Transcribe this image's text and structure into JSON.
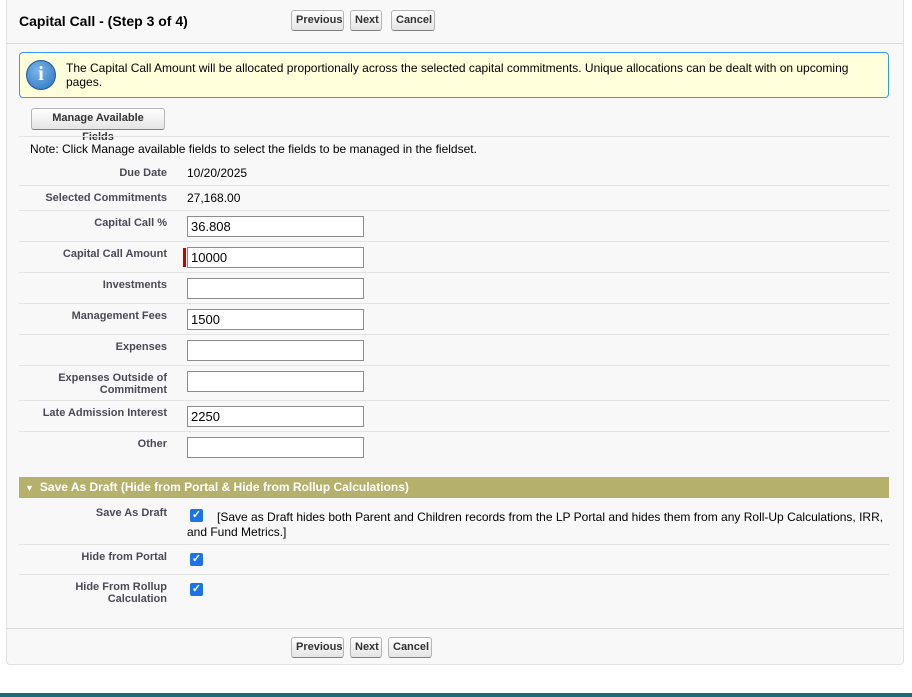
{
  "header": {
    "title": "Capital Call - (Step 3 of 4)"
  },
  "buttons": {
    "previous": "Previous",
    "next": "Next",
    "cancel": "Cancel"
  },
  "info": {
    "icon": "info-icon",
    "text": "The Capital Call Amount will be allocated proportionally across the selected capital commitments. Unique allocations can be dealt with on upcoming pages."
  },
  "manage_fields_label": "Manage Available Fields",
  "note": "Note: Click Manage available fields to select the fields to be managed in the fieldset.",
  "fields": {
    "due_date": {
      "label": "Due Date",
      "value": "10/20/2025"
    },
    "selected_commitments": {
      "label": "Selected Commitments",
      "value": "27,168.00"
    },
    "capital_call_pct": {
      "label": "Capital Call %",
      "value": "36.808"
    },
    "capital_call_amount": {
      "label": "Capital Call Amount",
      "value": "10000"
    },
    "investments": {
      "label": "Investments",
      "value": ""
    },
    "management_fees": {
      "label": "Management Fees",
      "value": "1500"
    },
    "expenses": {
      "label": "Expenses",
      "value": ""
    },
    "expenses_outside": {
      "label1": "Expenses Outside of",
      "label2": "Commitment",
      "value": ""
    },
    "late_admission_interest": {
      "label": "Late Admission Interest",
      "value": "2250"
    },
    "other": {
      "label": "Other",
      "value": ""
    }
  },
  "draft_section": {
    "title": "Save As Draft (Hide from Portal & Hide from Rollup Calculations)",
    "save_as_draft": {
      "label": "Save As Draft",
      "checked": true,
      "help_line1": "[Save as Draft hides both Parent and Children records from the LP Portal and hides them from any Roll-Up Calculations, IRR,",
      "help_line2": "and Fund Metrics.]"
    },
    "hide_from_portal": {
      "label": "Hide from Portal",
      "checked": true
    },
    "hide_from_rollup": {
      "label1": "Hide From Rollup",
      "label2": "Calculation",
      "checked": true
    }
  },
  "colors": {
    "section_header": "#b5b06c",
    "info_background": "#ffffdc",
    "info_border": "#3399ff",
    "required_marker": "#cc0000",
    "checkbox": "#1a73e8"
  }
}
